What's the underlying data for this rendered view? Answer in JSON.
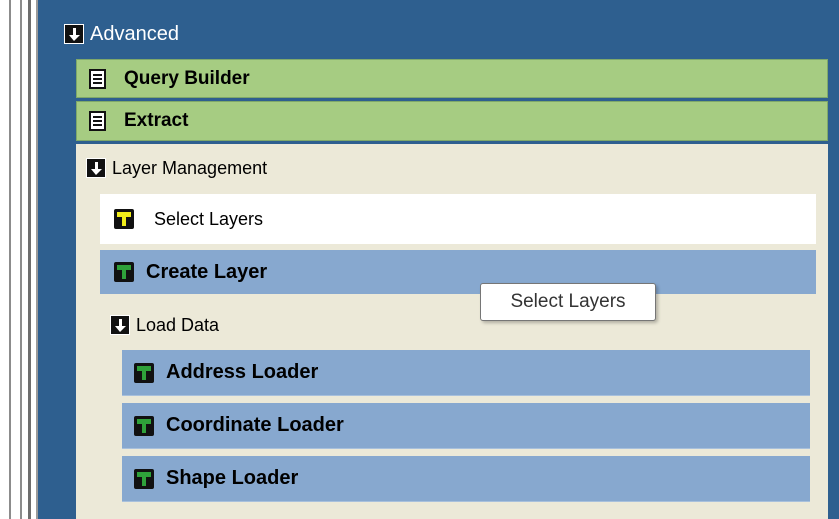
{
  "colors": {
    "panel_bg": "#2e5f8f",
    "green_item": "#a6cc82",
    "blue_item": "#87a8cf",
    "beige_bg": "#ece9d8",
    "selected_bg": "#ffffff"
  },
  "advanced": {
    "label": "Advanced",
    "icon": "collapse-arrow-icon",
    "items": [
      {
        "label": "Query Builder",
        "icon": "document-icon"
      },
      {
        "label": "Extract",
        "icon": "document-icon"
      }
    ]
  },
  "layer_management": {
    "label": "Layer Management",
    "icon": "collapse-arrow-icon",
    "items": [
      {
        "label": "Select Layers",
        "icon": "tool-icon",
        "selected": true
      },
      {
        "label": "Create Layer",
        "icon": "tool-icon"
      }
    ]
  },
  "load_data": {
    "label": "Load Data",
    "icon": "collapse-arrow-icon",
    "items": [
      {
        "label": "Address Loader",
        "icon": "tool-icon"
      },
      {
        "label": "Coordinate Loader",
        "icon": "tool-icon"
      },
      {
        "label": "Shape Loader",
        "icon": "tool-icon"
      }
    ]
  },
  "tooltip": {
    "text": "Select Layers"
  }
}
